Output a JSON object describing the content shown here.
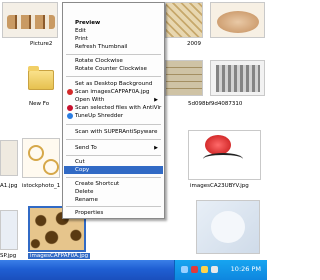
{
  "files": {
    "row1": [
      "Picture2",
      "2009"
    ],
    "row2": [
      "New Fo",
      "5d098bf9d4087310"
    ],
    "row3": [
      "A1.jpg",
      "istockphoto_1",
      "imagesCA23UBYV.jpg"
    ],
    "row4": [
      "SP.jpg",
      "imagesCAFPAF0A.jpg"
    ]
  },
  "menu": {
    "preview": "Preview",
    "edit": "Edit",
    "print": "Print",
    "refresh": "Refresh Thumbnail",
    "rotate_cw": "Rotate Clockwise",
    "rotate_ccw": "Rotate Counter Clockwise",
    "set_bg": "Set as Desktop Background",
    "scan": "Scan imagesCAFPAF0A.jpg",
    "open_with": "Open With",
    "scan_antivir": "Scan selected files with AntiVir",
    "tuneup": "TuneUp Shredder",
    "superanti": "Scan with SUPERAntiSpyware",
    "send_to": "Send To",
    "cut": "Cut",
    "copy": "Copy",
    "create_shortcut": "Create Shortcut",
    "delete": "Delete",
    "rename": "Rename",
    "properties": "Properties"
  },
  "taskbar": {
    "clock": "10:26 PM"
  }
}
